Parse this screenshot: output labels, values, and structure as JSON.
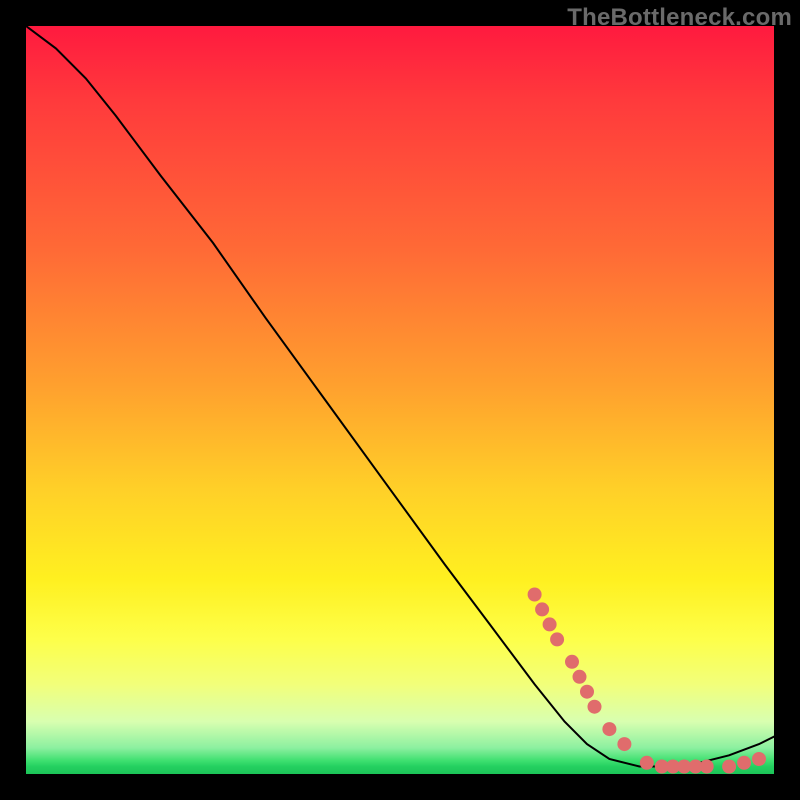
{
  "watermark": "TheBottleneck.com",
  "chart_data": {
    "type": "line",
    "title": "",
    "xlabel": "",
    "ylabel": "",
    "xlim": [
      0,
      100
    ],
    "ylim": [
      0,
      100
    ],
    "grid": false,
    "series": [
      {
        "name": "curve",
        "x": [
          0,
          4,
          8,
          12,
          18,
          25,
          32,
          40,
          48,
          56,
          62,
          68,
          72,
          75,
          78,
          82,
          86,
          90,
          94,
          98,
          100
        ],
        "y": [
          100,
          97,
          93,
          88,
          80,
          71,
          61,
          50,
          39,
          28,
          20,
          12,
          7,
          4,
          2,
          1,
          1,
          1.5,
          2.5,
          4,
          5
        ],
        "stroke": "#000000",
        "stroke_width": 2
      }
    ],
    "markers": [
      {
        "name": "dots",
        "color": "#e06c6c",
        "radius": 7,
        "points": [
          {
            "x": 68,
            "y": 24
          },
          {
            "x": 69,
            "y": 22
          },
          {
            "x": 70,
            "y": 20
          },
          {
            "x": 71,
            "y": 18
          },
          {
            "x": 73,
            "y": 15
          },
          {
            "x": 74,
            "y": 13
          },
          {
            "x": 75,
            "y": 11
          },
          {
            "x": 76,
            "y": 9
          },
          {
            "x": 78,
            "y": 6
          },
          {
            "x": 80,
            "y": 4
          },
          {
            "x": 83,
            "y": 1.5
          },
          {
            "x": 85,
            "y": 1
          },
          {
            "x": 86.5,
            "y": 1
          },
          {
            "x": 88,
            "y": 1
          },
          {
            "x": 89.5,
            "y": 1
          },
          {
            "x": 91,
            "y": 1
          },
          {
            "x": 94,
            "y": 1
          },
          {
            "x": 96,
            "y": 1.5
          },
          {
            "x": 98,
            "y": 2
          }
        ]
      }
    ]
  }
}
